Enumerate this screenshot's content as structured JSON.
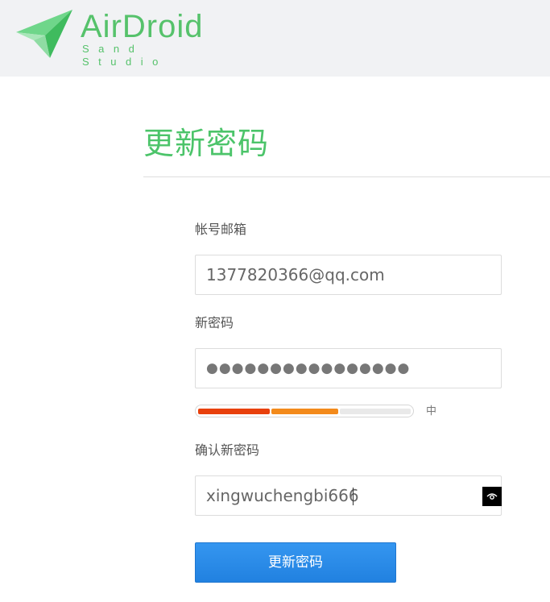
{
  "header": {
    "logo_name": "AirDroid",
    "logo_sub": "Sand Studio",
    "brand_color": "#56c26b",
    "icon": "paper-plane-logo-icon"
  },
  "page": {
    "title": "更新密码"
  },
  "form": {
    "account_label": "帐号邮箱",
    "account_value": "1377820366@qq.com",
    "new_password_label": "新密码",
    "new_password_masked": "●●●●●●●●●●●●●●●●",
    "strength": {
      "label": "中",
      "level": 2,
      "max_level": 3,
      "colors": [
        "#e8400c",
        "#f38a1b",
        "#e9e9e9"
      ]
    },
    "confirm_label": "确认新密码",
    "confirm_value": "xingwuchengbi666",
    "eye_icon": "eye-icon",
    "submit_label": "更新密码",
    "submit_color": "#2b8ae8"
  }
}
